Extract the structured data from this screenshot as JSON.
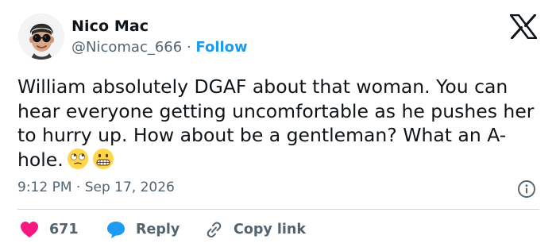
{
  "author": {
    "name": "Nico Mac",
    "handle": "@Nicomac_666",
    "separator": "·",
    "follow_label": "Follow"
  },
  "tweet": {
    "text": "William absolutely DGAF about that woman. You can hear everyone getting uncomfortable as he pushes her to hurry up. How about be a gentleman? What an A-hole.",
    "emojis": [
      "face-with-rolling-eyes",
      "grimacing-face"
    ],
    "time": "9:12 PM",
    "separator": "·",
    "date": "Sep 17, 2026"
  },
  "actions": {
    "like_count": "671",
    "reply_label": "Reply",
    "copy_label": "Copy link"
  },
  "icons": {
    "brand": "x-logo-icon",
    "info": "info-icon",
    "like": "heart-icon",
    "reply": "chat-bubble-icon",
    "copy": "link-icon"
  },
  "colors": {
    "text": "#0f1419",
    "muted": "#536471",
    "link": "#1d9bf0",
    "like": "#f91880",
    "divider": "#cfd9de"
  }
}
